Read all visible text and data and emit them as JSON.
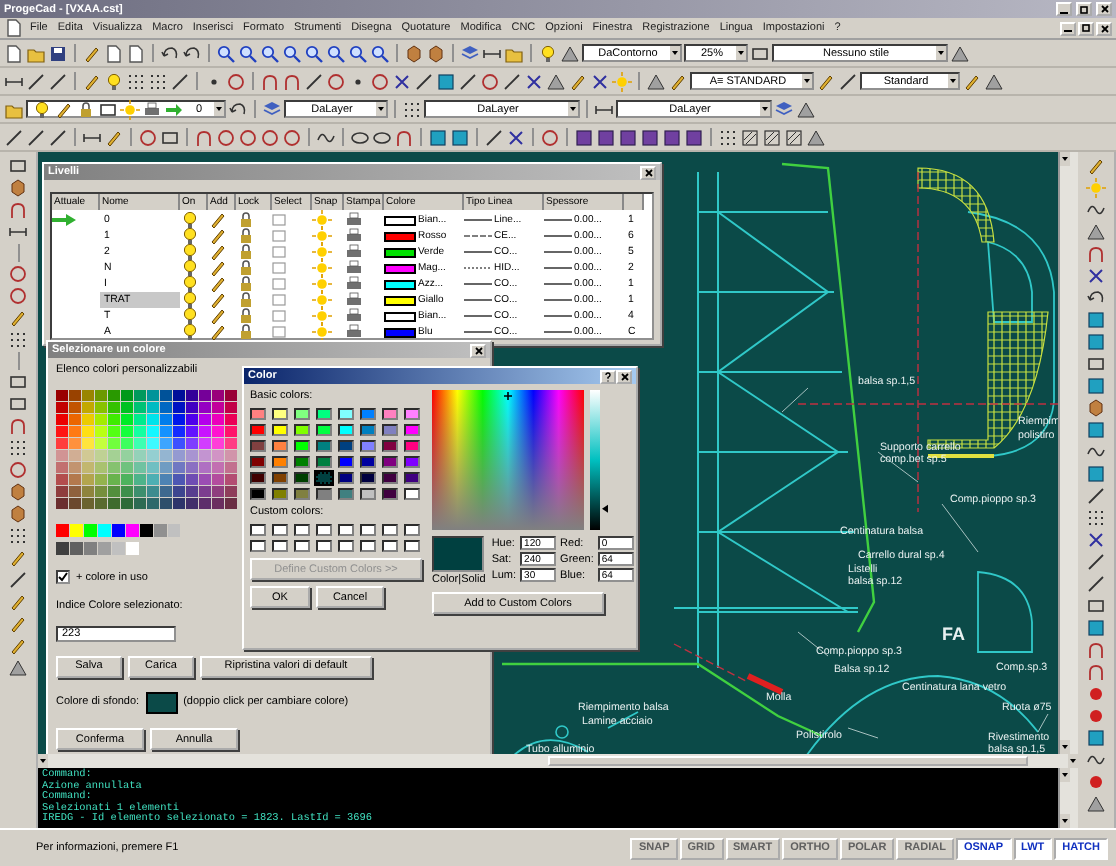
{
  "window": {
    "title": "ProgeCad - [VXAA.cst]"
  },
  "menu": [
    "File",
    "Edita",
    "Visualizza",
    "Macro",
    "Inserisci",
    "Formato",
    "Strumenti",
    "Disegna",
    "Quotature",
    "Modifica",
    "CNC",
    "Opzioni",
    "Finestra",
    "Registrazione",
    "Lingua",
    "Impostazioni",
    "?"
  ],
  "toolbars": {
    "zoom_style": "DaContorno",
    "zoom_percent": "25%",
    "visual_style": "Nessuno stile",
    "text_style": "A≡ STANDARD",
    "dim_style": "Standard",
    "layer": "0",
    "color_setting": "DaLayer",
    "linetype": "DaLayer",
    "lineweight": "DaLayer"
  },
  "layers_dialog": {
    "title": "Livelli",
    "columns": [
      "Attuale",
      "Nome",
      "On",
      "Add",
      "Lock",
      "Select",
      "Snap",
      "Stampa",
      "Colore",
      "Tipo Linea",
      "Spessore"
    ],
    "rows": [
      {
        "current": true,
        "select": false,
        "name": "0",
        "selected": false,
        "color": "#ffffff",
        "color_name": "Bian...",
        "linetype": "Line...",
        "weight": "0.00...",
        "column_12": "1"
      },
      {
        "current": false,
        "select": false,
        "name": "1",
        "selected": false,
        "color": "#ff0000",
        "color_name": "Rosso",
        "linetype": "CE...",
        "weight": "0.00...",
        "column_12": "6"
      },
      {
        "current": false,
        "select": false,
        "name": "2",
        "selected": false,
        "color": "#00e000",
        "color_name": "Verde",
        "linetype": "CO...",
        "weight": "0.00...",
        "column_12": "5"
      },
      {
        "current": false,
        "select": false,
        "name": "N",
        "selected": false,
        "color": "#ff00ff",
        "color_name": "Mag...",
        "linetype": "HID...",
        "weight": "0.00...",
        "column_12": "2"
      },
      {
        "current": false,
        "select": false,
        "name": "I",
        "selected": false,
        "color": "#00ffff",
        "color_name": "Azz...",
        "linetype": "CO...",
        "weight": "0.00...",
        "column_12": "1"
      },
      {
        "current": false,
        "select": false,
        "name": "TRAT",
        "selected": true,
        "color": "#ffff00",
        "color_name": "Giallo",
        "linetype": "CO...",
        "weight": "0.00...",
        "column_12": "1"
      },
      {
        "current": false,
        "select": false,
        "name": "T",
        "selected": false,
        "color": "#ffffff",
        "color_name": "Bian...",
        "linetype": "CO...",
        "weight": "0.00...",
        "column_12": "4"
      },
      {
        "current": false,
        "select": false,
        "name": "A",
        "selected": false,
        "color": "#0000ff",
        "color_name": "Blu",
        "linetype": "CO...",
        "weight": "0.00...",
        "column_12": "C"
      }
    ]
  },
  "color_picker": {
    "title": "Selezionare un colore",
    "palette_label": "Elenco colori personalizzabili",
    "show_in_use": {
      "label": "+ colore in uso",
      "checked": true
    },
    "index_label": "Indice Colore selezionato:",
    "index_value": "223",
    "buttons": [
      "Salva",
      "Carica",
      "Ripristina valori di default"
    ],
    "background_label": "Colore di sfondo:",
    "background_swatch": {
      "color": "#0b4a48"
    },
    "background_hint": "(doppio click per cambiare colore)",
    "confirm_buttons": [
      "Conferma",
      "Annulla"
    ]
  },
  "color_dialog": {
    "title": "Color",
    "basic_label": "Basic colors:",
    "basic_colors": [
      {
        "color": "#ff8080",
        "selected": false
      },
      {
        "color": "#ffff80",
        "selected": false
      },
      {
        "color": "#80ff80",
        "selected": false
      },
      {
        "color": "#00ff80",
        "selected": false
      },
      {
        "color": "#80ffff",
        "selected": false
      },
      {
        "color": "#0080ff",
        "selected": false
      },
      {
        "color": "#ff80c0",
        "selected": false
      },
      {
        "color": "#ff80ff",
        "selected": false
      },
      {
        "color": "#ff0000",
        "selected": false
      },
      {
        "color": "#ffff00",
        "selected": false
      },
      {
        "color": "#80ff00",
        "selected": false
      },
      {
        "color": "#00ff40",
        "selected": false
      },
      {
        "color": "#00ffff",
        "selected": false
      },
      {
        "color": "#0080c0",
        "selected": false
      },
      {
        "color": "#8080c0",
        "selected": false
      },
      {
        "color": "#ff00ff",
        "selected": false
      },
      {
        "color": "#804040",
        "selected": false
      },
      {
        "color": "#ff8040",
        "selected": false
      },
      {
        "color": "#00ff00",
        "selected": false
      },
      {
        "color": "#008080",
        "selected": false
      },
      {
        "color": "#004080",
        "selected": false
      },
      {
        "color": "#8080ff",
        "selected": false
      },
      {
        "color": "#800040",
        "selected": false
      },
      {
        "color": "#ff0080",
        "selected": false
      },
      {
        "color": "#800000",
        "selected": false
      },
      {
        "color": "#ff8000",
        "selected": false
      },
      {
        "color": "#008000",
        "selected": false
      },
      {
        "color": "#008040",
        "selected": false
      },
      {
        "color": "#0000ff",
        "selected": false
      },
      {
        "color": "#0000a0",
        "selected": false
      },
      {
        "color": "#800080",
        "selected": false
      },
      {
        "color": "#8000ff",
        "selected": false
      },
      {
        "color": "#400000",
        "selected": false
      },
      {
        "color": "#804000",
        "selected": false
      },
      {
        "color": "#004000",
        "selected": false
      },
      {
        "color": "#004040",
        "selected": true
      },
      {
        "color": "#000080",
        "selected": false
      },
      {
        "color": "#000040",
        "selected": false
      },
      {
        "color": "#400040",
        "selected": false
      },
      {
        "color": "#400080",
        "selected": false
      },
      {
        "color": "#000000",
        "selected": false
      },
      {
        "color": "#808000",
        "selected": false
      },
      {
        "color": "#808040",
        "selected": false
      },
      {
        "color": "#808080",
        "selected": false
      },
      {
        "color": "#408080",
        "selected": false
      },
      {
        "color": "#c0c0c0",
        "selected": false
      },
      {
        "color": "#400040",
        "selected": false
      },
      {
        "color": "#ffffff",
        "selected": false
      }
    ],
    "custom_label": "Custom colors:",
    "define_button": {
      "label": "Define Custom Colors >>",
      "disabled": true
    },
    "ok": "OK",
    "cancel": "Cancel",
    "preview_label": "Color|Solid",
    "preview": {
      "color": "#004040"
    },
    "luminance": {
      "level": 0.13
    },
    "fields": [
      {
        "label": "Hue:",
        "value": "120"
      },
      {
        "label": "Red:",
        "value": "0"
      },
      {
        "label": "Sat:",
        "value": "240"
      },
      {
        "label": "Green:",
        "value": "64"
      },
      {
        "label": "Lum:",
        "value": "30"
      },
      {
        "label": "Blue:",
        "value": "64"
      }
    ],
    "add_button": "Add to Custom Colors"
  },
  "drawing_labels": [
    "balsa sp.1,5",
    "Supporto carrello",
    "comp.bet sp.5",
    "Riempim",
    "polistiro",
    "Comp.pioppo sp.3",
    "Centinatura balsa",
    "Carrello dural sp.4",
    "Listelli",
    "balsa sp.12",
    "FA",
    "Comp.pioppo sp.3",
    "Balsa sp.12",
    "Comp.sp.3",
    "Centinatura lana vetro",
    "Ruota ø75",
    "Molla",
    "Polistirolo",
    "Rivestimento",
    "balsa sp.1,5",
    "Riempimento balsa",
    "Lamine acciaio",
    "Tubo alluminio"
  ],
  "command_lines": [
    "Command:",
    "Azione annullata",
    "Command:",
    "Selezionati 1 elementi",
    "IREDG - Id elemento selezionato = 1823. LastId = 3696"
  ],
  "status_bar": {
    "hint": "Per informazioni, premere F1",
    "toggles": [
      {
        "label": "SNAP",
        "on": false
      },
      {
        "label": "GRID",
        "on": false
      },
      {
        "label": "SMART",
        "on": false
      },
      {
        "label": "ORTHO",
        "on": false
      },
      {
        "label": "POLAR",
        "on": false
      },
      {
        "label": "RADIAL",
        "on": false
      },
      {
        "label": "OSNAP",
        "on": true
      },
      {
        "label": "LWT",
        "on": true
      },
      {
        "label": "HATCH",
        "on": true
      }
    ]
  }
}
